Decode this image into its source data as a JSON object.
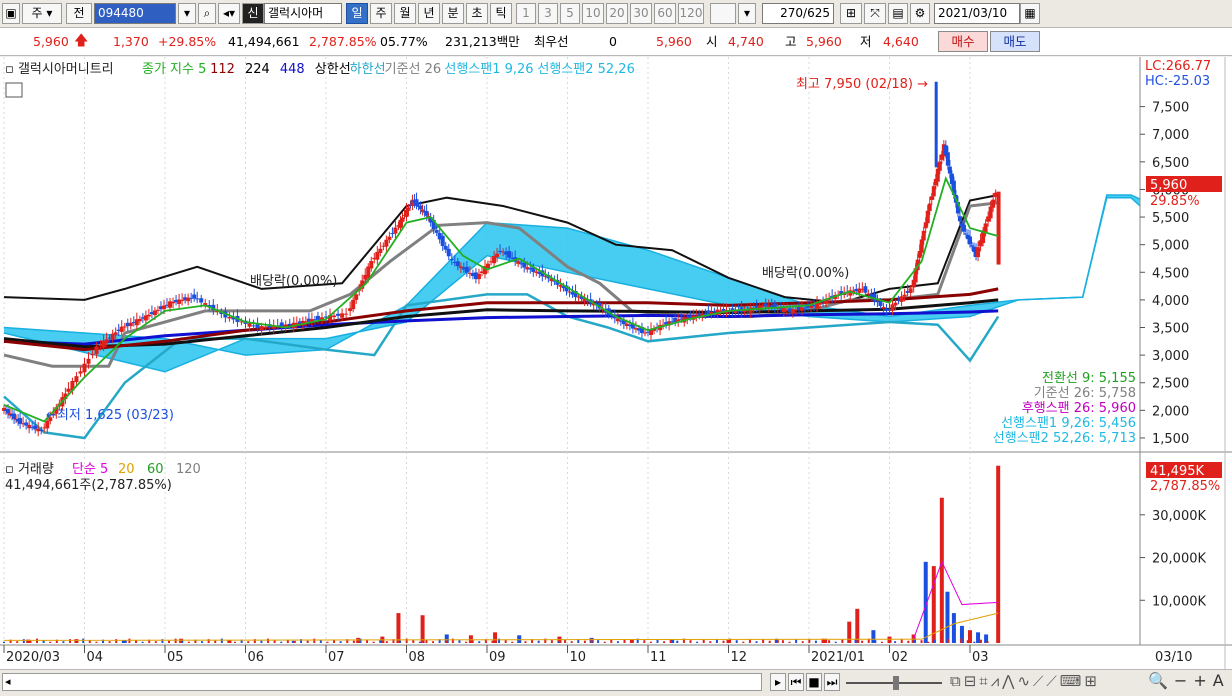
{
  "toolbar": {
    "market_label": "주",
    "prev_label": "전",
    "code_value": "094480",
    "new_badge": "신",
    "stock_name": "갤럭시아머",
    "periods": [
      "일",
      "주",
      "월",
      "년",
      "분",
      "초",
      "틱"
    ],
    "selected_period": "일",
    "intervals": [
      "1",
      "3",
      "5",
      "10",
      "20",
      "30",
      "60",
      "120"
    ],
    "count_value": "270",
    "count_total": "/625",
    "date_value": "2021/03/10"
  },
  "quote": {
    "price": "5,960",
    "change": "1,370",
    "change_rate": "+29.85%",
    "volume": "41,494,661",
    "volume_rate": "2,787.85%",
    "turnover": "05.77%",
    "amount": "231,213백만",
    "best_label": "최우선",
    "best_value": "0",
    "last": "5,960",
    "open_label": "시",
    "open_value": "4,740",
    "high_label": "고",
    "high_value": "5,960",
    "low_label": "저",
    "low_value": "4,640",
    "buy_label": "매수",
    "sell_label": "매도"
  },
  "colors": {
    "up": "#e0211b",
    "down": "#1a4fe0",
    "cloud": "#33c8f0",
    "accent_blue": "#3470c8"
  },
  "legend": {
    "price_title": "갤럭시아머니트리",
    "price_items": [
      {
        "text": "종가 지수 5",
        "color": "#22b022"
      },
      {
        "text": "112",
        "color": "#8b0000"
      },
      {
        "text": "224",
        "color": "#000000"
      },
      {
        "text": "448",
        "color": "#1010d0"
      },
      {
        "text": "상한선",
        "color": "#000000"
      },
      {
        "text": "하한선",
        "color": "#25a8c8"
      },
      {
        "text": "기준선 26",
        "color": "#808080"
      },
      {
        "text": "선행스팬1 9,26",
        "color": "#20b8e0"
      },
      {
        "text": "선행스팬2 52,26",
        "color": "#20b8e0"
      }
    ],
    "volume_title": "거래량",
    "volume_items": [
      {
        "text": "단순 5",
        "color": "#e000e0"
      },
      {
        "text": "20",
        "color": "#e0a000"
      },
      {
        "text": "60",
        "color": "#20a020"
      },
      {
        "text": "120",
        "color": "#808080"
      }
    ],
    "volume_info": "41,494,661주(2,787.85%)"
  },
  "annotations": {
    "high": "최고 7,950 (02/18)",
    "low": "최저 1,625 (03/23)",
    "dividend1": "배당락(0.00%)",
    "dividend2": "배당락(0.00%)",
    "lc": "LC:266.77",
    "hc": "HC:-25.03",
    "price_tag": "5,960",
    "pct_tag": "29.85%",
    "vol_tag": "41,495K",
    "vol_pct": "2,787.85%",
    "date_tag": "03/10"
  },
  "indicator_values": [
    {
      "text": "전환선 9: 5,155",
      "color": "#20a020"
    },
    {
      "text": "기준선 26: 5,758",
      "color": "#808080"
    },
    {
      "text": "후행스팬 26: 5,960",
      "color": "#c000c0"
    },
    {
      "text": "선행스팬1 9,26: 5,456",
      "color": "#20b8e0"
    },
    {
      "text": "선행스팬2 52,26: 5,713",
      "color": "#20b8e0"
    }
  ],
  "chart_data": [
    {
      "type": "line",
      "name": "price",
      "y_ticks": [
        1500,
        2000,
        2500,
        3000,
        3500,
        4000,
        4500,
        5000,
        5500,
        6000,
        6500,
        7000,
        7500
      ],
      "x_labels": [
        "2020/03",
        "04",
        "05",
        "06",
        "07",
        "08",
        "09",
        "10",
        "11",
        "12",
        "2021/01",
        "02",
        "03"
      ],
      "x_months": [
        0,
        1,
        2,
        3,
        4,
        5,
        6,
        7,
        8,
        9,
        10,
        11,
        12
      ],
      "ylim": [
        1300,
        8000
      ],
      "close": [
        [
          0,
          2050
        ],
        [
          0.2,
          1800
        ],
        [
          0.5,
          1625
        ],
        [
          0.8,
          2300
        ],
        [
          1.2,
          3150
        ],
        [
          1.5,
          3500
        ],
        [
          1.8,
          3700
        ],
        [
          2.1,
          3950
        ],
        [
          2.4,
          4050
        ],
        [
          2.8,
          3700
        ],
        [
          3.2,
          3500
        ],
        [
          3.6,
          3550
        ],
        [
          3.9,
          3650
        ],
        [
          4.3,
          3750
        ],
        [
          4.6,
          4700
        ],
        [
          4.9,
          5300
        ],
        [
          5.1,
          5800
        ],
        [
          5.3,
          5500
        ],
        [
          5.6,
          4700
        ],
        [
          5.9,
          4400
        ],
        [
          6.2,
          4900
        ],
        [
          6.5,
          4600
        ],
        [
          6.8,
          4400
        ],
        [
          7.1,
          4100
        ],
        [
          7.4,
          3900
        ],
        [
          7.7,
          3600
        ],
        [
          8.0,
          3400
        ],
        [
          8.3,
          3600
        ],
        [
          8.6,
          3700
        ],
        [
          8.9,
          3800
        ],
        [
          9.2,
          3800
        ],
        [
          9.5,
          3900
        ],
        [
          9.8,
          3800
        ],
        [
          10.1,
          3900
        ],
        [
          10.4,
          4100
        ],
        [
          10.7,
          4200
        ],
        [
          11.0,
          3800
        ],
        [
          11.3,
          4200
        ],
        [
          11.5,
          5600
        ],
        [
          11.7,
          6800
        ],
        [
          11.9,
          5400
        ],
        [
          12.1,
          4800
        ],
        [
          12.35,
          5960
        ]
      ],
      "ma5": [
        [
          0,
          2100
        ],
        [
          0.5,
          1800
        ],
        [
          1.0,
          2600
        ],
        [
          1.5,
          3300
        ],
        [
          2.0,
          3800
        ],
        [
          2.5,
          3900
        ],
        [
          3.0,
          3600
        ],
        [
          3.5,
          3500
        ],
        [
          4.0,
          3650
        ],
        [
          4.5,
          4300
        ],
        [
          5.0,
          5400
        ],
        [
          5.3,
          5500
        ],
        [
          5.7,
          4800
        ],
        [
          6.0,
          4550
        ],
        [
          6.4,
          4750
        ],
        [
          6.8,
          4400
        ],
        [
          7.2,
          4050
        ],
        [
          7.6,
          3700
        ],
        [
          8.0,
          3450
        ],
        [
          8.5,
          3650
        ],
        [
          9.0,
          3800
        ],
        [
          9.5,
          3850
        ],
        [
          10.0,
          3900
        ],
        [
          10.5,
          4150
        ],
        [
          11.0,
          3950
        ],
        [
          11.4,
          4700
        ],
        [
          11.7,
          6200
        ],
        [
          12.0,
          5300
        ],
        [
          12.35,
          5155
        ]
      ],
      "ma112": [
        [
          0,
          3250
        ],
        [
          1,
          3100
        ],
        [
          2,
          3250
        ],
        [
          3,
          3450
        ],
        [
          4,
          3600
        ],
        [
          5,
          3800
        ],
        [
          6,
          3950
        ],
        [
          7,
          3950
        ],
        [
          8,
          3950
        ],
        [
          9,
          3900
        ],
        [
          10,
          3950
        ],
        [
          11,
          4000
        ],
        [
          12,
          4100
        ],
        [
          12.35,
          4200
        ]
      ],
      "ma224": [
        [
          0,
          3300
        ],
        [
          1,
          3150
        ],
        [
          2,
          3200
        ],
        [
          3,
          3350
        ],
        [
          4,
          3500
        ],
        [
          5,
          3700
        ],
        [
          6,
          3820
        ],
        [
          7,
          3800
        ],
        [
          8,
          3790
        ],
        [
          9,
          3770
        ],
        [
          10,
          3800
        ],
        [
          11,
          3830
        ],
        [
          12,
          3950
        ],
        [
          12.35,
          4000
        ]
      ],
      "ma448": [
        [
          0,
          3250
        ],
        [
          1,
          3200
        ],
        [
          2,
          3350
        ],
        [
          3,
          3450
        ],
        [
          4,
          3550
        ],
        [
          5,
          3620
        ],
        [
          6,
          3680
        ],
        [
          7,
          3700
        ],
        [
          8,
          3720
        ],
        [
          9,
          3700
        ],
        [
          10,
          3730
        ],
        [
          11,
          3750
        ],
        [
          12,
          3780
        ],
        [
          12.35,
          3800
        ]
      ],
      "upper": [
        [
          0,
          4050
        ],
        [
          1,
          4000
        ],
        [
          1.5,
          4200
        ],
        [
          2.4,
          4600
        ],
        [
          3.2,
          4200
        ],
        [
          4.2,
          4300
        ],
        [
          5.0,
          5700
        ],
        [
          5.5,
          5850
        ],
        [
          6.2,
          5700
        ],
        [
          7.0,
          5400
        ],
        [
          7.6,
          5000
        ],
        [
          8.3,
          4900
        ],
        [
          9.0,
          4400
        ],
        [
          9.7,
          4050
        ],
        [
          10.4,
          3950
        ],
        [
          11.0,
          4200
        ],
        [
          11.6,
          4300
        ],
        [
          12.0,
          5800
        ],
        [
          12.35,
          5900
        ]
      ],
      "lower": [
        [
          0,
          2250
        ],
        [
          0.5,
          1600
        ],
        [
          1.0,
          1500
        ],
        [
          1.5,
          2500
        ],
        [
          2.2,
          3300
        ],
        [
          3.0,
          3300
        ],
        [
          4.0,
          3100
        ],
        [
          4.6,
          3000
        ],
        [
          5.0,
          3900
        ],
        [
          5.5,
          4000
        ],
        [
          6.0,
          4100
        ],
        [
          6.5,
          4100
        ],
        [
          7.0,
          3700
        ],
        [
          7.5,
          3500
        ],
        [
          8.0,
          3250
        ],
        [
          9.0,
          3400
        ],
        [
          10.0,
          3500
        ],
        [
          11.0,
          3600
        ],
        [
          11.6,
          3550
        ],
        [
          12.0,
          2900
        ],
        [
          12.35,
          3700
        ]
      ],
      "kijun": [
        [
          0,
          3000
        ],
        [
          0.6,
          2800
        ],
        [
          1.3,
          2800
        ],
        [
          1.5,
          3400
        ],
        [
          2.5,
          3800
        ],
        [
          3.2,
          3800
        ],
        [
          3.8,
          3800
        ],
        [
          4.3,
          4100
        ],
        [
          4.8,
          4700
        ],
        [
          5.4,
          5350
        ],
        [
          6.0,
          5400
        ],
        [
          6.4,
          5300
        ],
        [
          7.0,
          4600
        ],
        [
          7.4,
          4300
        ],
        [
          7.8,
          3800
        ],
        [
          8.5,
          3700
        ],
        [
          9.3,
          3700
        ],
        [
          10.0,
          3800
        ],
        [
          10.5,
          4000
        ],
        [
          11.0,
          4000
        ],
        [
          11.6,
          4100
        ],
        [
          12.0,
          5700
        ],
        [
          12.35,
          5758
        ]
      ],
      "span1": [
        [
          0,
          3500
        ],
        [
          2,
          3300
        ],
        [
          3,
          3000
        ],
        [
          4,
          3100
        ],
        [
          5,
          3900
        ],
        [
          6,
          5400
        ],
        [
          7,
          5300
        ],
        [
          8,
          4900
        ],
        [
          9,
          4400
        ],
        [
          10,
          3900
        ],
        [
          11,
          3700
        ],
        [
          12,
          3900
        ],
        [
          12.6,
          4000
        ],
        [
          13.4,
          4050
        ],
        [
          13.7,
          5900
        ],
        [
          14.0,
          5900
        ],
        [
          14.3,
          5700
        ]
      ],
      "span2": [
        [
          0,
          3400
        ],
        [
          2,
          2700
        ],
        [
          3,
          3300
        ],
        [
          4,
          3300
        ],
        [
          5,
          3600
        ],
        [
          6,
          4800
        ],
        [
          7,
          4500
        ],
        [
          8,
          4200
        ],
        [
          9,
          3900
        ],
        [
          10,
          3700
        ],
        [
          11,
          3600
        ],
        [
          12,
          3700
        ],
        [
          12.6,
          4000
        ],
        [
          13.4,
          4050
        ],
        [
          13.7,
          5850
        ],
        [
          14.0,
          5850
        ],
        [
          14.3,
          5450
        ]
      ]
    },
    {
      "type": "bar",
      "name": "volume",
      "y_ticks": [
        10000,
        20000,
        30000
      ],
      "ylim": [
        0,
        44000
      ],
      "unit": "K",
      "bars": [
        [
          0.3,
          800,
          "up"
        ],
        [
          0.9,
          900,
          "up"
        ],
        [
          1.5,
          700,
          "down"
        ],
        [
          2.2,
          1000,
          "up"
        ],
        [
          2.8,
          600,
          "up"
        ],
        [
          3.6,
          500,
          "down"
        ],
        [
          4.4,
          1200,
          "up"
        ],
        [
          4.7,
          1500,
          "up"
        ],
        [
          4.9,
          7000,
          "up"
        ],
        [
          5.2,
          6500,
          "up"
        ],
        [
          5.5,
          2000,
          "down"
        ],
        [
          5.8,
          1800,
          "up"
        ],
        [
          6.1,
          2500,
          "up"
        ],
        [
          6.4,
          1800,
          "down"
        ],
        [
          6.9,
          1500,
          "up"
        ],
        [
          7.3,
          1200,
          "down"
        ],
        [
          7.8,
          900,
          "up"
        ],
        [
          8.3,
          800,
          "down"
        ],
        [
          9.0,
          700,
          "up"
        ],
        [
          9.6,
          800,
          "up"
        ],
        [
          10.2,
          1000,
          "up"
        ],
        [
          10.5,
          5000,
          "up"
        ],
        [
          10.6,
          8000,
          "up"
        ],
        [
          10.8,
          3000,
          "down"
        ],
        [
          11.0,
          1500,
          "up"
        ],
        [
          11.3,
          2000,
          "up"
        ],
        [
          11.45,
          19000,
          "down"
        ],
        [
          11.55,
          18000,
          "up"
        ],
        [
          11.65,
          34000,
          "up"
        ],
        [
          11.72,
          12000,
          "down"
        ],
        [
          11.8,
          7000,
          "down"
        ],
        [
          11.9,
          4000,
          "down"
        ],
        [
          12.0,
          3000,
          "up"
        ],
        [
          12.1,
          2500,
          "down"
        ],
        [
          12.2,
          2000,
          "down"
        ],
        [
          12.35,
          41495,
          "up"
        ]
      ]
    }
  ]
}
